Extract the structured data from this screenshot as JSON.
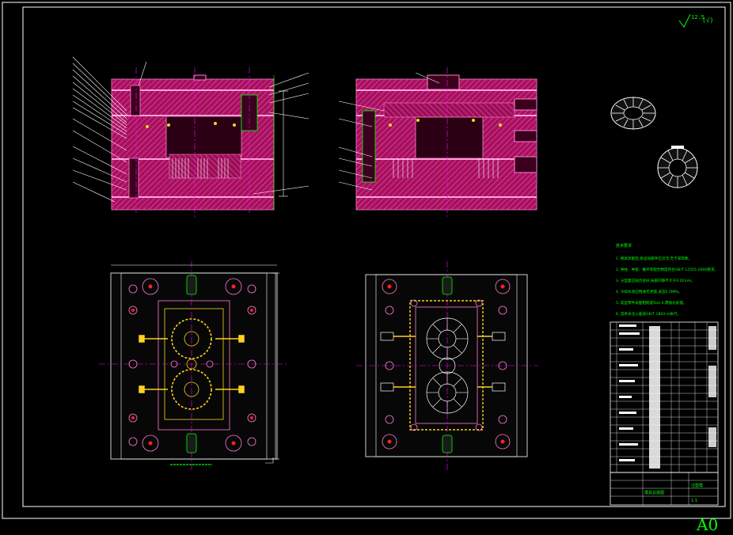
{
  "sheet": {
    "size_label": "A0",
    "roughness_mark": "12.5",
    "roughness_rest": "(√)"
  },
  "notes": {
    "title": "技术要求",
    "lines": [
      "1. 模具装配后,各运动部件应灵活,无卡滞现象。",
      "2. 导柱、导套、推杆等配合精度符合GB/T 12555-2006要求。",
      "3. 分型面应贴合良好,局部间隙不大于0.02mm。",
      "4. 冷却水道应畅通无泄漏,试压0.5MPa。",
      "5. 成型零件表面粗糙度Ra0.4,需抛光处理。",
      "6. 其余未注公差按GB/T 1804-m执行。"
    ]
  },
  "title_block": {
    "drawing_name": "模具总装图",
    "school": "注塑模",
    "scale": "1:1"
  },
  "colors": {
    "frame": "#ffffff",
    "steel": "#b30d6e",
    "hatch": "#e04aa8",
    "center": "#ff00ff",
    "green": "#00ff00",
    "yellow": "#ffd21f",
    "red": "#ff2020",
    "white": "#ffffff",
    "accent": "#00ff00"
  }
}
